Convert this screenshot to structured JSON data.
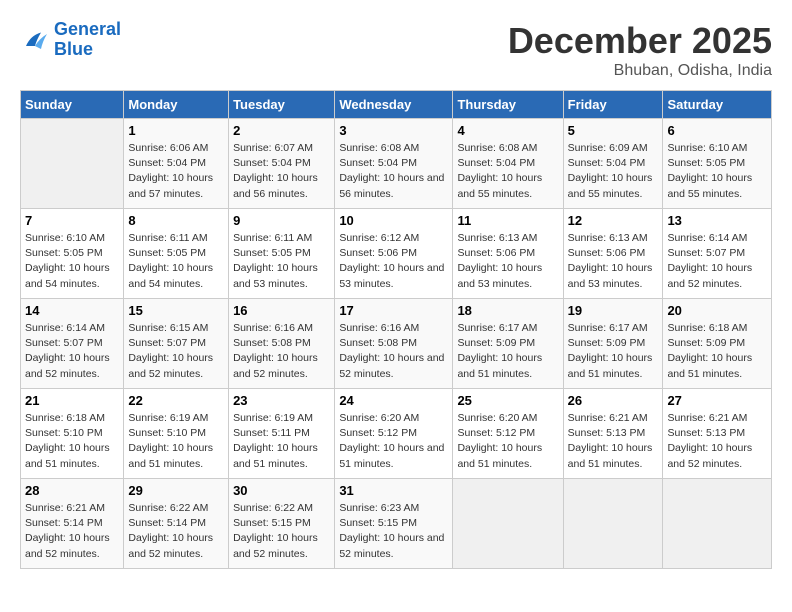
{
  "logo": {
    "line1": "General",
    "line2": "Blue"
  },
  "title": "December 2025",
  "location": "Bhuban, Odisha, India",
  "weekdays": [
    "Sunday",
    "Monday",
    "Tuesday",
    "Wednesday",
    "Thursday",
    "Friday",
    "Saturday"
  ],
  "weeks": [
    [
      {
        "day": "",
        "sunrise": "",
        "sunset": "",
        "daylight": ""
      },
      {
        "day": "1",
        "sunrise": "6:06 AM",
        "sunset": "5:04 PM",
        "daylight": "10 hours and 57 minutes."
      },
      {
        "day": "2",
        "sunrise": "6:07 AM",
        "sunset": "5:04 PM",
        "daylight": "10 hours and 56 minutes."
      },
      {
        "day": "3",
        "sunrise": "6:08 AM",
        "sunset": "5:04 PM",
        "daylight": "10 hours and 56 minutes."
      },
      {
        "day": "4",
        "sunrise": "6:08 AM",
        "sunset": "5:04 PM",
        "daylight": "10 hours and 55 minutes."
      },
      {
        "day": "5",
        "sunrise": "6:09 AM",
        "sunset": "5:04 PM",
        "daylight": "10 hours and 55 minutes."
      },
      {
        "day": "6",
        "sunrise": "6:10 AM",
        "sunset": "5:05 PM",
        "daylight": "10 hours and 55 minutes."
      }
    ],
    [
      {
        "day": "7",
        "sunrise": "6:10 AM",
        "sunset": "5:05 PM",
        "daylight": "10 hours and 54 minutes."
      },
      {
        "day": "8",
        "sunrise": "6:11 AM",
        "sunset": "5:05 PM",
        "daylight": "10 hours and 54 minutes."
      },
      {
        "day": "9",
        "sunrise": "6:11 AM",
        "sunset": "5:05 PM",
        "daylight": "10 hours and 53 minutes."
      },
      {
        "day": "10",
        "sunrise": "6:12 AM",
        "sunset": "5:06 PM",
        "daylight": "10 hours and 53 minutes."
      },
      {
        "day": "11",
        "sunrise": "6:13 AM",
        "sunset": "5:06 PM",
        "daylight": "10 hours and 53 minutes."
      },
      {
        "day": "12",
        "sunrise": "6:13 AM",
        "sunset": "5:06 PM",
        "daylight": "10 hours and 53 minutes."
      },
      {
        "day": "13",
        "sunrise": "6:14 AM",
        "sunset": "5:07 PM",
        "daylight": "10 hours and 52 minutes."
      }
    ],
    [
      {
        "day": "14",
        "sunrise": "6:14 AM",
        "sunset": "5:07 PM",
        "daylight": "10 hours and 52 minutes."
      },
      {
        "day": "15",
        "sunrise": "6:15 AM",
        "sunset": "5:07 PM",
        "daylight": "10 hours and 52 minutes."
      },
      {
        "day": "16",
        "sunrise": "6:16 AM",
        "sunset": "5:08 PM",
        "daylight": "10 hours and 52 minutes."
      },
      {
        "day": "17",
        "sunrise": "6:16 AM",
        "sunset": "5:08 PM",
        "daylight": "10 hours and 52 minutes."
      },
      {
        "day": "18",
        "sunrise": "6:17 AM",
        "sunset": "5:09 PM",
        "daylight": "10 hours and 51 minutes."
      },
      {
        "day": "19",
        "sunrise": "6:17 AM",
        "sunset": "5:09 PM",
        "daylight": "10 hours and 51 minutes."
      },
      {
        "day": "20",
        "sunrise": "6:18 AM",
        "sunset": "5:09 PM",
        "daylight": "10 hours and 51 minutes."
      }
    ],
    [
      {
        "day": "21",
        "sunrise": "6:18 AM",
        "sunset": "5:10 PM",
        "daylight": "10 hours and 51 minutes."
      },
      {
        "day": "22",
        "sunrise": "6:19 AM",
        "sunset": "5:10 PM",
        "daylight": "10 hours and 51 minutes."
      },
      {
        "day": "23",
        "sunrise": "6:19 AM",
        "sunset": "5:11 PM",
        "daylight": "10 hours and 51 minutes."
      },
      {
        "day": "24",
        "sunrise": "6:20 AM",
        "sunset": "5:12 PM",
        "daylight": "10 hours and 51 minutes."
      },
      {
        "day": "25",
        "sunrise": "6:20 AM",
        "sunset": "5:12 PM",
        "daylight": "10 hours and 51 minutes."
      },
      {
        "day": "26",
        "sunrise": "6:21 AM",
        "sunset": "5:13 PM",
        "daylight": "10 hours and 51 minutes."
      },
      {
        "day": "27",
        "sunrise": "6:21 AM",
        "sunset": "5:13 PM",
        "daylight": "10 hours and 52 minutes."
      }
    ],
    [
      {
        "day": "28",
        "sunrise": "6:21 AM",
        "sunset": "5:14 PM",
        "daylight": "10 hours and 52 minutes."
      },
      {
        "day": "29",
        "sunrise": "6:22 AM",
        "sunset": "5:14 PM",
        "daylight": "10 hours and 52 minutes."
      },
      {
        "day": "30",
        "sunrise": "6:22 AM",
        "sunset": "5:15 PM",
        "daylight": "10 hours and 52 minutes."
      },
      {
        "day": "31",
        "sunrise": "6:23 AM",
        "sunset": "5:15 PM",
        "daylight": "10 hours and 52 minutes."
      },
      {
        "day": "",
        "sunrise": "",
        "sunset": "",
        "daylight": ""
      },
      {
        "day": "",
        "sunrise": "",
        "sunset": "",
        "daylight": ""
      },
      {
        "day": "",
        "sunrise": "",
        "sunset": "",
        "daylight": ""
      }
    ]
  ]
}
